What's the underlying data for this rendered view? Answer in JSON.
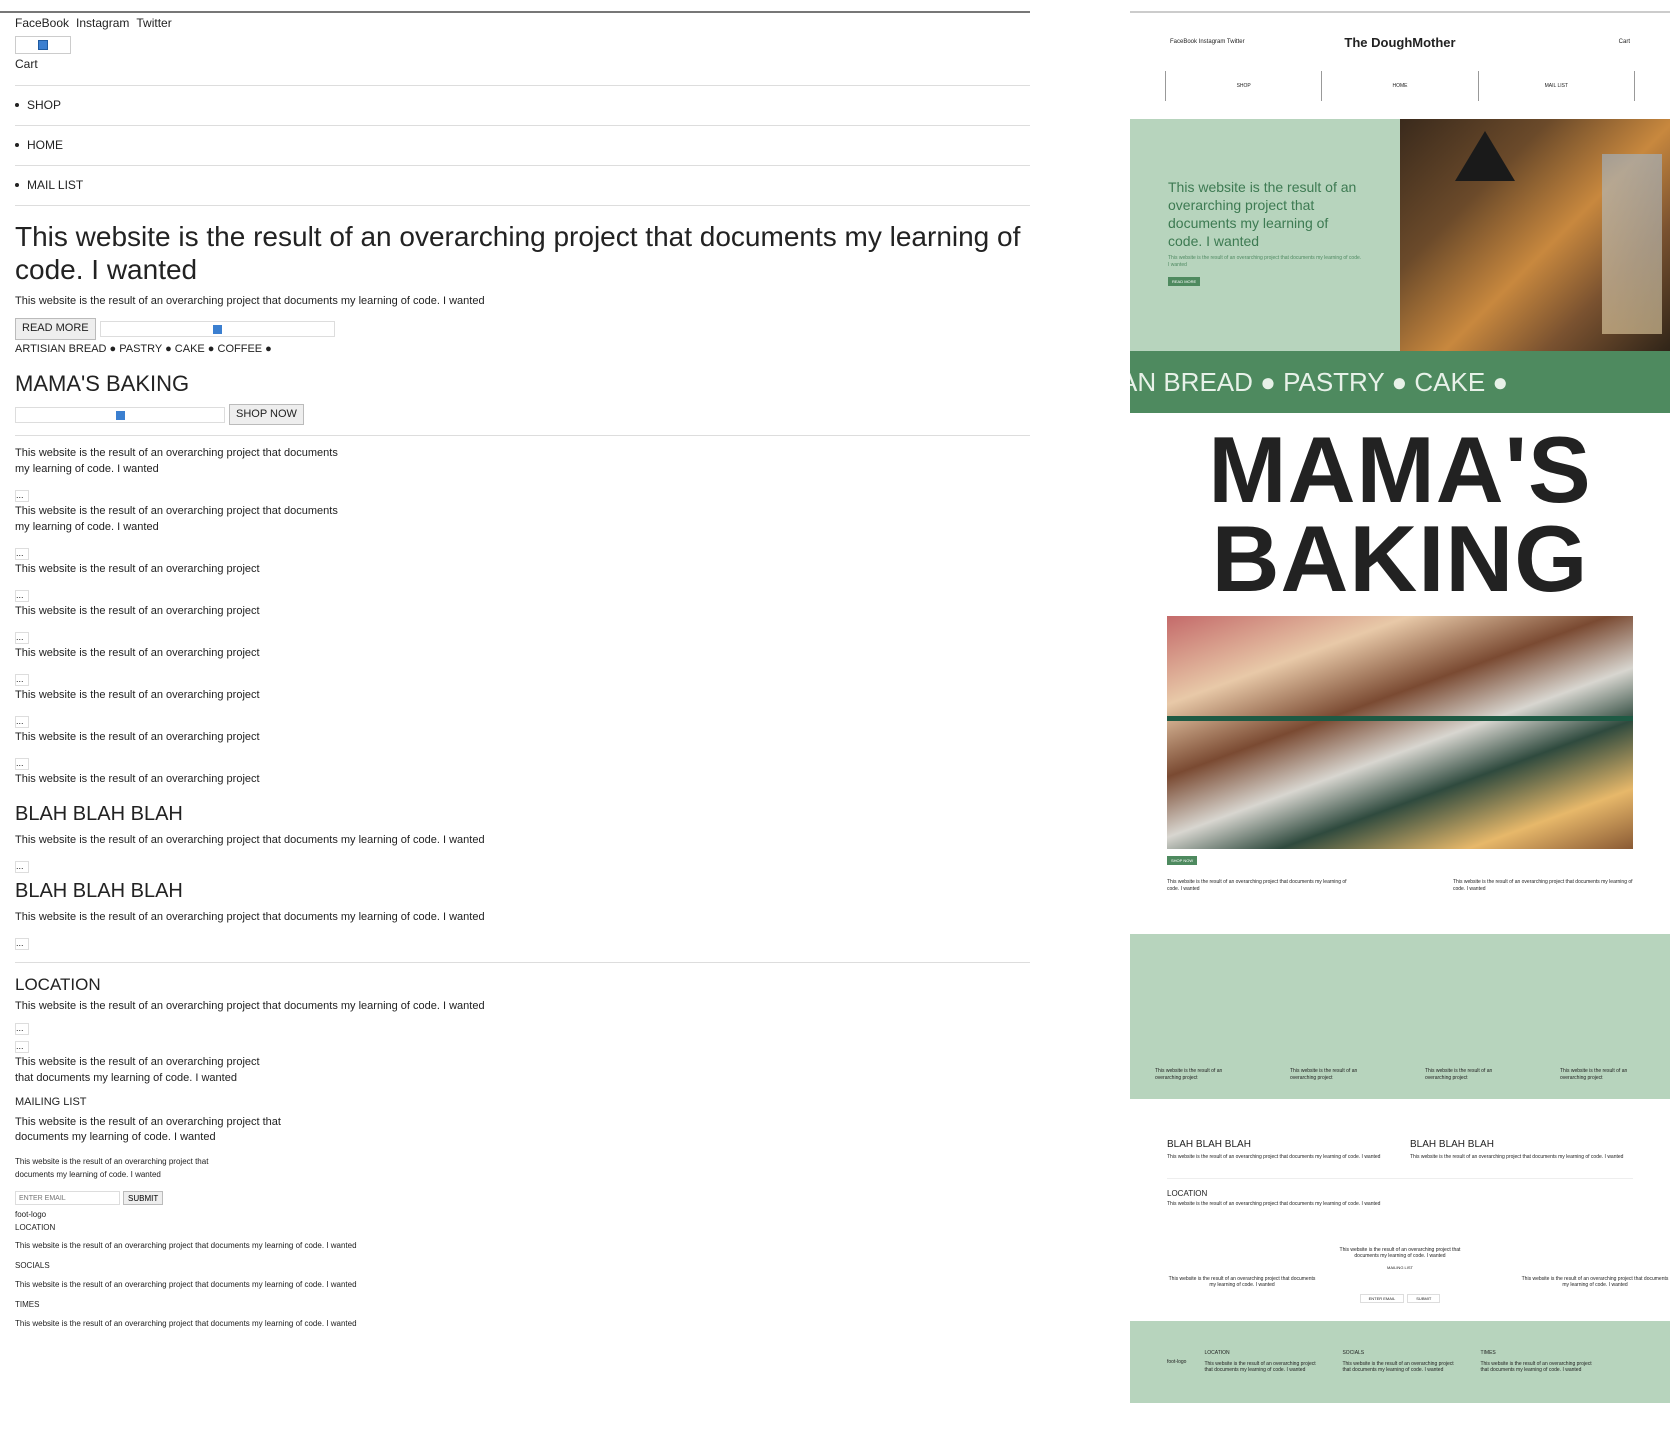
{
  "raw": {
    "socials": [
      "FaceBook",
      "Instagram",
      "Twitter"
    ],
    "cart": "Cart",
    "nav": [
      "SHOP",
      "HOME",
      "MAIL LIST"
    ],
    "hero_title": "This website is the result of an overarching project that documents my learning of code. I wanted",
    "hero_text": "This website is the result of an overarching project that documents my learning of code. I wanted",
    "read_more": "READ MORE",
    "marquee": "ARTISIAN BREAD ● PASTRY ● CAKE ● COFFEE ●",
    "mama": "MAMA'S BAKING",
    "shop_now": "SHOP NOW",
    "blurb_long": "This website is the result of an overarching project that documents",
    "blurb_long2": "my learning of code. I wanted",
    "blurb_short": "This website is the result of an overarching project",
    "ellipsis": "...",
    "blah": "BLAH BLAH BLAH",
    "full_text": "This website is the result of an overarching project that documents my learning of code. I wanted",
    "location": "LOCATION",
    "loc_text_a": "This website is the result of an overarching project",
    "loc_text_b": "that documents my learning of code. I wanted",
    "mailing_list": "MAILING LIST",
    "mail_text_a": "This website is the result of an overarching project that",
    "mail_text_b": "documents my learning of code. I wanted",
    "tiny_a": "This website is the result of an overarching project that",
    "tiny_b": "documents my learning of code. I wanted",
    "email_placeholder": "ENTER EMAIL",
    "submit": "SUBMIT",
    "foot_logo": "foot-logo",
    "foot_location": "LOCATION",
    "foot_socials": "SOCIALS",
    "foot_times": "TIMES",
    "foot_text": "This website is the result of an overarching project that documents my learning of code. I wanted"
  },
  "styled": {
    "socials": "FaceBook Instagram Twitter",
    "logo": "The DoughMother",
    "cart": "Cart",
    "nav": [
      "SHOP",
      "HOME",
      "MAIL LIST"
    ],
    "hero_title": "This website is the result of an overarching project that documents my learning of code. I wanted",
    "hero_text": "This website is the result of an overarching project that documents my learning of code. I wanted",
    "read_more": "READ MORE",
    "marquee": "AN BREAD ● PASTRY ● CAKE ●",
    "mama_line1": "MAMA'S",
    "mama_line2": "BAKING",
    "shop_now": "SHOP NOW",
    "two_a": "This website is the result of an overarching project that documents my learning of code. I wanted",
    "two_b": "This website is the result of an overarching project that documents my learning of code. I wanted",
    "green_items": [
      "This website is the result of an overarching project",
      "This website is the result of an overarching project",
      "This website is the result of an overarching project",
      "This website is the result of an overarching project"
    ],
    "blah": "BLAH BLAH BLAH",
    "blah_text": "This website is the result of an overarching project that documents my learning of code. I wanted",
    "location": "LOCATION",
    "location_text": "This website is the result of an overarching project that documents my learning of code. I wanted",
    "mail_center": "This website is the result of an overarching project that documents my learning of code. I wanted",
    "mailing_list": "MAILING LIST",
    "mail_left": "This website is the result of an overarching project that documents my learning of code. I wanted",
    "mail_right": "This website is the result of an overarching project that documents my learning of code. I wanted",
    "email_placeholder": "ENTER EMAIL",
    "submit": "SUBMIT",
    "foot_logo": "foot-logo",
    "foot_location": "LOCATION",
    "foot_socials": "SOCIALS",
    "foot_times": "TIMES",
    "foot_text": "This website is the result of an overarching project that documents my learning of code. I wanted"
  }
}
